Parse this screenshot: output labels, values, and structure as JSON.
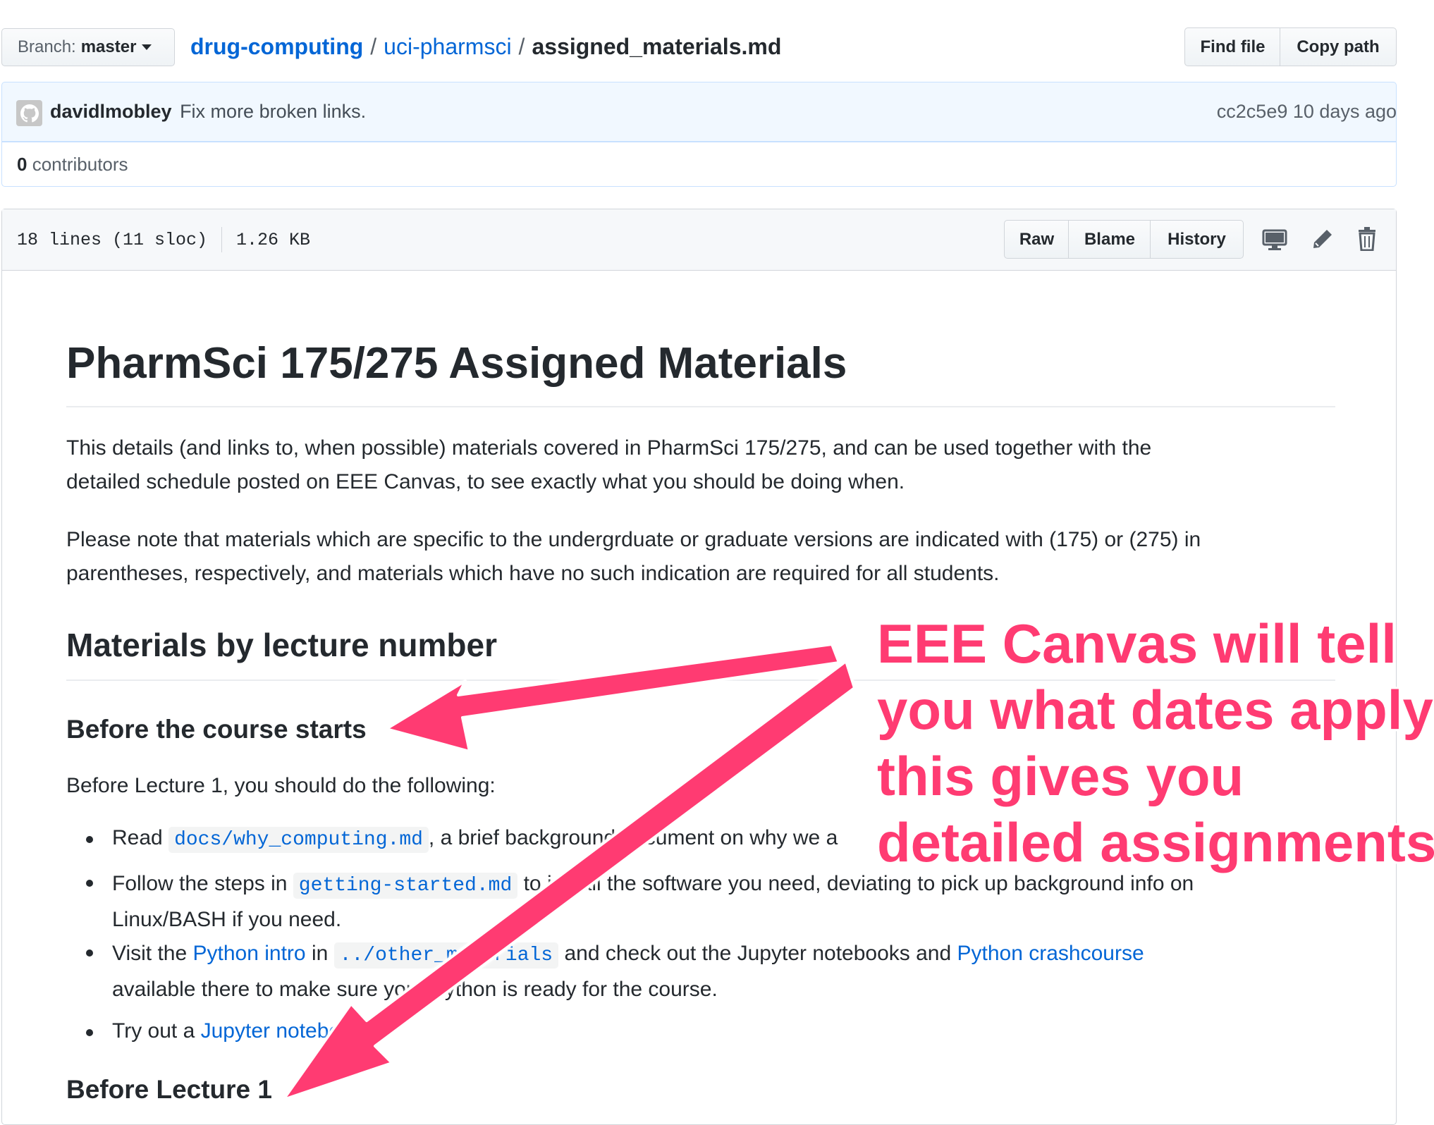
{
  "branch": {
    "label": "Branch:",
    "value": "master"
  },
  "breadcrumb": {
    "repo": "drug-computing",
    "folder": "uci-pharmsci",
    "sep": "/",
    "file": "assigned_materials.md"
  },
  "file_actions": {
    "find_file": "Find file",
    "copy_path": "Copy path"
  },
  "commit": {
    "author": "davidlmobley",
    "message": "Fix more broken links.",
    "sha": "cc2c5e9",
    "age": "10 days ago"
  },
  "contributors": {
    "count": "0",
    "label": "contributors"
  },
  "file_info": {
    "lines": "18 lines (11 sloc)",
    "size": "1.26 KB"
  },
  "view_buttons": {
    "raw": "Raw",
    "blame": "Blame",
    "history": "History"
  },
  "doc": {
    "title": "PharmSci 175/275 Assigned Materials",
    "intro_line1": "This details (and links to, when possible) materials covered in PharmSci 175/275, and can be used together with the",
    "intro_line2": "detailed schedule posted on EEE Canvas, to see exactly what you should be doing when.",
    "note_line1": "Please note that materials which are specific to the undergrduate or graduate versions are indicated with (175) or (275) in",
    "note_line2": "parentheses, respectively, and materials which have no such indication are required for all students.",
    "h2": "Materials by lecture number",
    "h3_before_course": "Before the course starts",
    "before_lecture_text": "Before Lecture 1, you should do the following:",
    "bullet1_pre": "Read",
    "bullet1_code": "docs/why_computing.md",
    "bullet1_post": ", a brief background document on why we a",
    "bullet2_pre": "Follow the steps in",
    "bullet2_code": "getting-started.md",
    "bullet2_post": "to install the software you need, deviating to pick up background info on",
    "bullet2_line2": "Linux/BASH if you need.",
    "bullet3_pre": "Visit the",
    "bullet3_link1": "Python intro",
    "bullet3_in": "in",
    "bullet3_code": "../other_materials",
    "bullet3_mid": "and check out the Jupyter notebooks and",
    "bullet3_link2": "Python crashcourse",
    "bullet3_line2": "available there to make sure your Python is ready for the course.",
    "bullet4_pre": "Try out a",
    "bullet4_link": "Jupyter notebook",
    "h3_before_lecture1": "Before Lecture 1"
  },
  "annotation": {
    "line1": "EEE Canvas will tell",
    "line2": "you what dates apply;",
    "line3": "this gives you",
    "line4": "detailed assignments",
    "color": "#ff3b72"
  }
}
